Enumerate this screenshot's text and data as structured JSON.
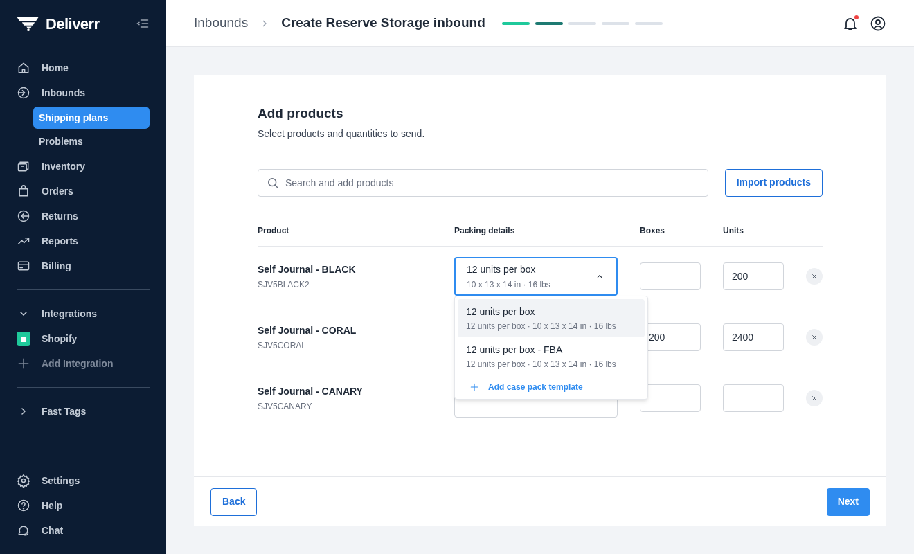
{
  "sidebar": {
    "logo": "Deliverr",
    "nav": [
      {
        "label": "Home",
        "selected": false
      },
      {
        "label": "Inbounds",
        "selected": false,
        "children": [
          {
            "label": "Shipping plans",
            "selected": true
          },
          {
            "label": "Problems",
            "selected": false
          }
        ]
      },
      {
        "label": "Inventory",
        "selected": false
      },
      {
        "label": "Orders",
        "selected": false
      },
      {
        "label": "Returns",
        "selected": false
      },
      {
        "label": "Reports",
        "selected": false
      },
      {
        "label": "Billing",
        "selected": false
      }
    ],
    "integrations": {
      "label": "Integrations",
      "expanded": true,
      "items": [
        {
          "label": "Shopify",
          "kind": "app"
        },
        {
          "label": "Add Integration",
          "kind": "add"
        }
      ]
    },
    "fast_tags": {
      "label": "Fast Tags",
      "expanded": false
    },
    "bottom": [
      {
        "label": "Settings"
      },
      {
        "label": "Help"
      },
      {
        "label": "Chat"
      }
    ]
  },
  "header": {
    "breadcrumb": "Inbounds",
    "title": "Create Reserve Storage inbound",
    "steps": [
      {
        "kind": "done"
      },
      {
        "kind": "current"
      },
      {
        "kind": "todo"
      },
      {
        "kind": "todo"
      },
      {
        "kind": "todo"
      }
    ],
    "notifications_unread": true
  },
  "card": {
    "title": "Add products",
    "subtitle": "Select products and quantities to send.",
    "search": {
      "placeholder": "Search and add products"
    },
    "import_button": "Import products",
    "columns": [
      "Product",
      "Packing details",
      "Boxes",
      "Units"
    ],
    "rows": [
      {
        "name": "Self Journal - BLACK",
        "sku": "SJV5BLACK2",
        "packing": {
          "label": "12 units per box",
          "detail": "10 x 13 x 14 in · 16 lbs",
          "expanded": true
        },
        "boxes": "",
        "units": "200"
      },
      {
        "name": "Self Journal - CORAL",
        "sku": "SJV5CORAL",
        "boxes": "200",
        "units": "2400"
      },
      {
        "name": "Self Journal - CANARY",
        "sku": "SJV5CANARY",
        "boxes": "",
        "units": ""
      }
    ],
    "dropdown": {
      "options": [
        {
          "label": "12 units per box",
          "detail": "12 units per box · 10 x 13 x 14 in · 16 lbs",
          "selected": true
        },
        {
          "label": "12 units per box - FBA",
          "detail": "12 units per box · 10 x 13 x 14 in · 16 lbs",
          "selected": false
        }
      ],
      "add_label": "Add case pack template"
    },
    "back_button": "Back",
    "next_button": "Next"
  }
}
